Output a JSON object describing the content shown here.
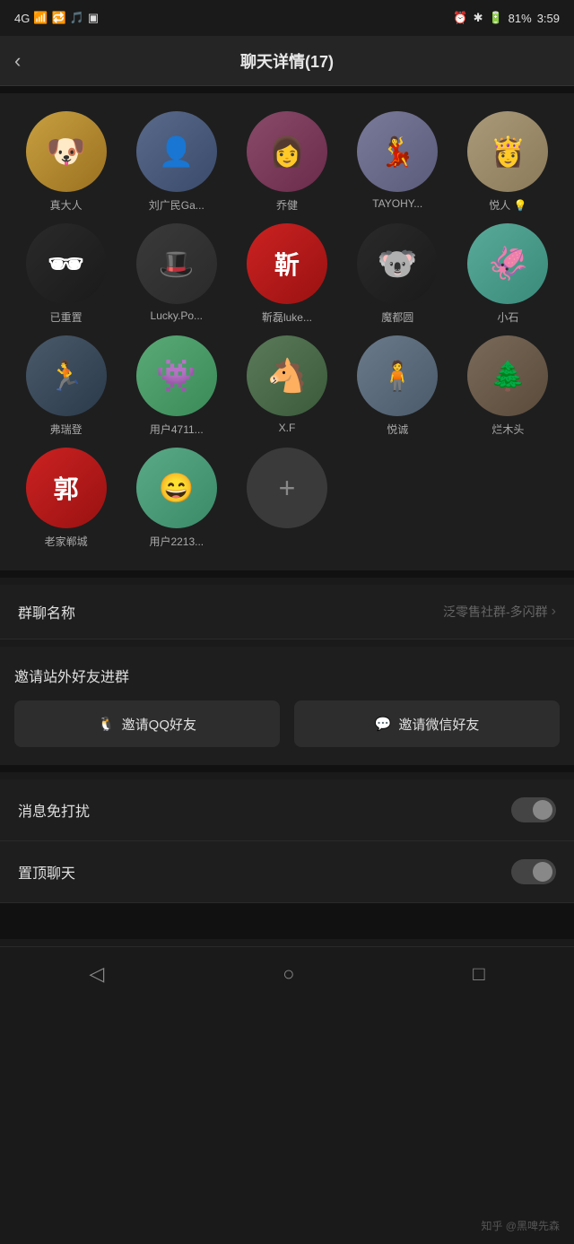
{
  "statusBar": {
    "network": "4G",
    "time": "3:59",
    "battery": "81%"
  },
  "header": {
    "back": "‹",
    "title": "聊天详情(17)"
  },
  "members": [
    {
      "id": 1,
      "name": "真大人",
      "avatarClass": "av-dog",
      "avatarContent": "🐕"
    },
    {
      "id": 2,
      "name": "刘广民Ga...",
      "avatarClass": "av-man1",
      "avatarContent": "👤"
    },
    {
      "id": 3,
      "name": "乔健",
      "avatarClass": "av-girl1",
      "avatarContent": "👩"
    },
    {
      "id": 4,
      "name": "TAYOHY...",
      "avatarClass": "av-hanfu",
      "avatarContent": "💃"
    },
    {
      "id": 5,
      "name": "悦人 💡",
      "avatarClass": "av-vintage",
      "avatarContent": "👸"
    },
    {
      "id": 6,
      "name": "已重置",
      "avatarClass": "av-tiktok",
      "avatarContent": "🕶"
    },
    {
      "id": 7,
      "name": "Lucky.Po...",
      "avatarClass": "av-lucky",
      "avatarContent": "🎩"
    },
    {
      "id": 8,
      "name": "靳磊luke...",
      "avatarClass": "av-red",
      "avatarContent": "靳"
    },
    {
      "id": 9,
      "name": "魔都圆",
      "avatarClass": "av-bear",
      "avatarContent": "🐼"
    },
    {
      "id": 10,
      "name": "小石",
      "avatarClass": "av-cyan",
      "avatarContent": "🐙"
    },
    {
      "id": 11,
      "name": "弗瑞登",
      "avatarClass": "av-runner",
      "avatarContent": "🏃"
    },
    {
      "id": 12,
      "name": "用户4711...",
      "avatarClass": "av-monster",
      "avatarContent": "👾"
    },
    {
      "id": 13,
      "name": "X.F",
      "avatarClass": "av-horse",
      "avatarContent": "🐎"
    },
    {
      "id": 14,
      "name": "悦诚",
      "avatarClass": "av-yucheng",
      "avatarContent": "🧍"
    },
    {
      "id": 15,
      "name": "烂木头",
      "avatarClass": "av-wood",
      "avatarContent": "🌲"
    },
    {
      "id": 16,
      "name": "老家郸城",
      "avatarClass": "av-laojia",
      "avatarContent": "郭"
    },
    {
      "id": 17,
      "name": "用户2213...",
      "avatarClass": "av-user2213",
      "avatarContent": "😄"
    }
  ],
  "addButton": "+",
  "groupName": {
    "label": "群聊名称",
    "value": "泛零售社群-多闪群"
  },
  "inviteSection": {
    "title": "邀请站外好友进群",
    "qqBtn": "邀请QQ好友",
    "wechatBtn": "邀请微信好友"
  },
  "toggleSection": {
    "dnd": {
      "label": "消息免打扰",
      "enabled": false
    },
    "pin": {
      "label": "置顶聊天",
      "enabled": false
    }
  },
  "bottomNav": {
    "back": "◁",
    "home": "○",
    "recent": "□"
  },
  "watermark": "知乎 @黑啤先森"
}
